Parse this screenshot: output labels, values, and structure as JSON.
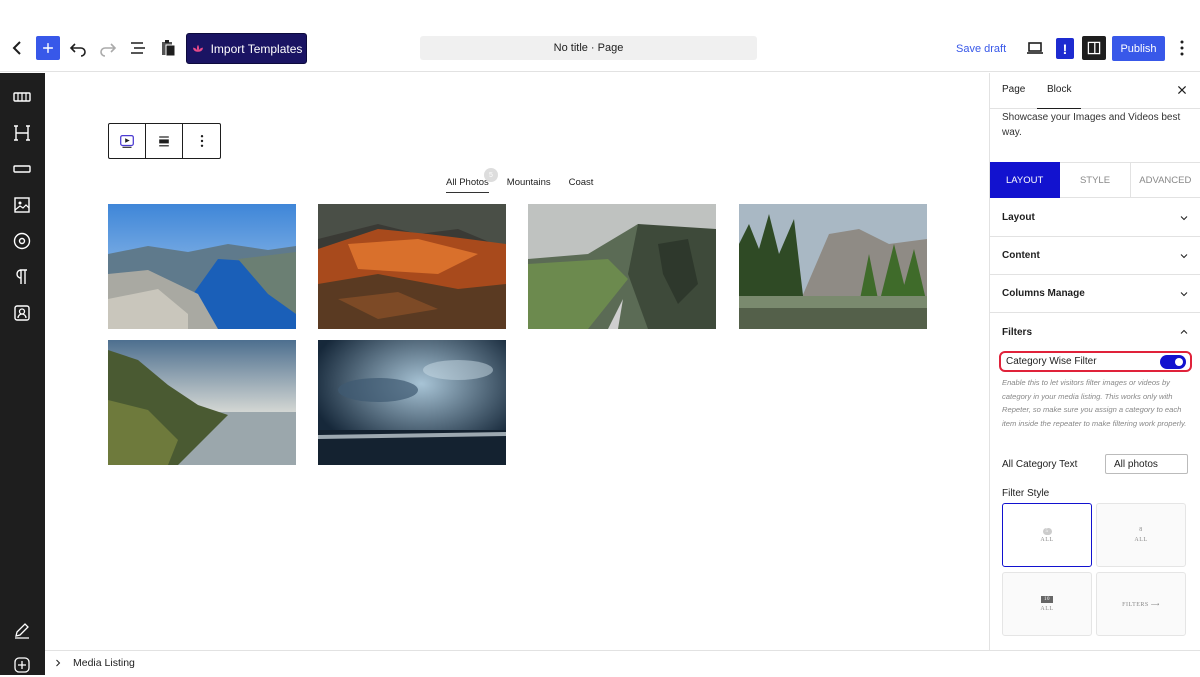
{
  "topbar": {
    "import_label": "Import Templates",
    "doc_title": "No title · Page",
    "save_draft": "Save draft",
    "excl": "!",
    "publish": "Publish"
  },
  "canvas": {
    "filters": [
      {
        "label": "All Photos",
        "count": "5"
      },
      {
        "label": "Mountains"
      },
      {
        "label": "Coast"
      }
    ]
  },
  "status": {
    "breadcrumb": "Media Listing"
  },
  "panel": {
    "tabs": [
      "Page",
      "Block"
    ],
    "description": "Showcase your Images and Videos best way.",
    "sub_tabs": [
      "LAYOUT",
      "STYLE",
      "ADVANCED"
    ],
    "sections": [
      "Layout",
      "Content",
      "Columns Manage",
      "Filters"
    ],
    "toggle_label": "Category Wise Filter",
    "help_text": "Enable this to let visitors filter images or videos by category in your media listing. This works only with Repeter, so make sure you assign a category to each item inside the repeater to make filtering work properly.",
    "all_category_label": "All Category Text",
    "all_category_value": "All photos",
    "filter_style_label": "Filter Style",
    "style_cards": [
      {
        "badge": "5",
        "text": "ALL"
      },
      {
        "badge": "8",
        "text": "ALL"
      },
      {
        "badge": "10",
        "text": "ALL"
      },
      {
        "text": "FILTERS ⟶"
      }
    ]
  },
  "colors": {
    "accent": "#3858e9",
    "tab_active": "#1212cf",
    "import_bg": "#1a1463",
    "highlight": "#e0223a"
  }
}
